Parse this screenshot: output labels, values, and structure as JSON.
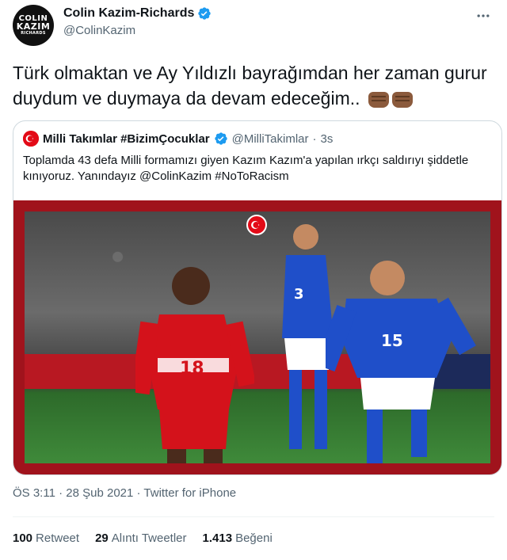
{
  "author": {
    "avatar_line1": "COLIN",
    "avatar_line2": "KAZIM",
    "avatar_line3": "RICHARDS",
    "display_name": "Colin Kazim-Richards",
    "handle": "@ColinKazim",
    "verified": true
  },
  "tweet": {
    "text": "Türk olmaktan ve Ay Yıldızlı bayrağımdan her zaman gurur duydum ve duymaya da devam edeceğim..",
    "emoji": [
      "fist-emoji",
      "fist-emoji"
    ]
  },
  "quoted": {
    "display_name": "Milli Takımlar #BizimÇocuklar",
    "handle": "@MilliTakimlar",
    "separator": "·",
    "time": "3s",
    "text": "Toplamda 43 defa Milli formamızı giyen Kazım Kazım'a yapılan ırkçı saldırıyı şiddetle kınıyoruz. Yanındayız @ColinKazim #NoToRacism",
    "photo_numbers": [
      "18",
      "15",
      "3"
    ]
  },
  "meta": {
    "time": "ÖS 3:11",
    "separator1": "·",
    "date": "28 Şub 2021",
    "separator2": "·",
    "source": "Twitter for iPhone"
  },
  "stats": {
    "retweets_count": "100",
    "retweets_label": "Retweet",
    "quotes_count": "29",
    "quotes_label": "Alıntı Tweetler",
    "likes_count": "1.413",
    "likes_label": "Beğeni"
  },
  "colors": {
    "verified": "#1d9bf0",
    "turkey_red": "#e30a17",
    "frame_red": "#a0131c",
    "azerbaijan_blue": "#1f4fc9"
  },
  "icons": {
    "more": "more-icon"
  }
}
